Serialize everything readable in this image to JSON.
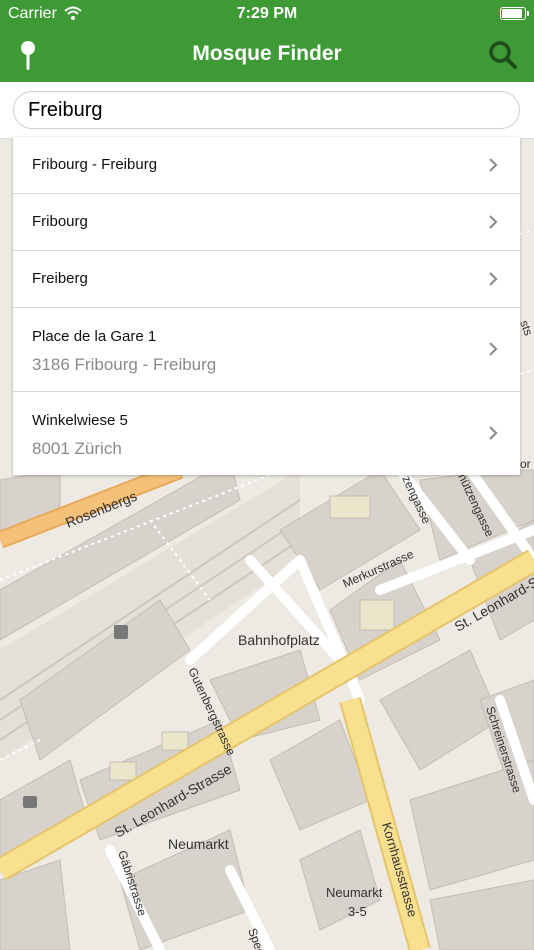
{
  "status_bar": {
    "carrier": "Carrier",
    "time": "7:29 PM"
  },
  "nav": {
    "title": "Mosque Finder",
    "left_icon": "map-pin-icon",
    "right_icon": "search-icon"
  },
  "search": {
    "value": "Freiburg"
  },
  "results": [
    {
      "line1": "Fribourg - Freiburg"
    },
    {
      "line1": "Fribourg"
    },
    {
      "line1": "Freiberg"
    },
    {
      "line1": "Place de la Gare 1",
      "line2": "3186 Fribourg - Freiburg"
    },
    {
      "line1": "Winkelwiese 5",
      "line2": "8001 Zürich"
    }
  ],
  "map": {
    "labels": {
      "rosenberg": "Rosenbergs",
      "merkur": "Merkurstrasse",
      "bahnhofplatz": "Bahnhofplatz",
      "gutenberg": "Gutenbergstrasse",
      "leonhard1": "St. Leonhard-Strasse",
      "leonhard2": "St. Leonhard-Strasse",
      "neumarkt": "Neumarkt",
      "neumarkt35a": "Neumarkt",
      "neumarkt35b": "3-5",
      "kornhaus": "Kornhausstrasse",
      "gabris": "Gäbristrasse",
      "schreiner": "Schreinerstrasse",
      "zengasse": "zengasse",
      "schuetzen": "hützengasse",
      "spee": "Spee",
      "edge_sts": "sts",
      "edge_or": "or"
    },
    "colors": {
      "background": "#ede9e3",
      "building": "#d7d2cb",
      "major_road": "#f8e08e",
      "minor_road": "#ffffff",
      "navbar": "#3e9a34"
    }
  }
}
